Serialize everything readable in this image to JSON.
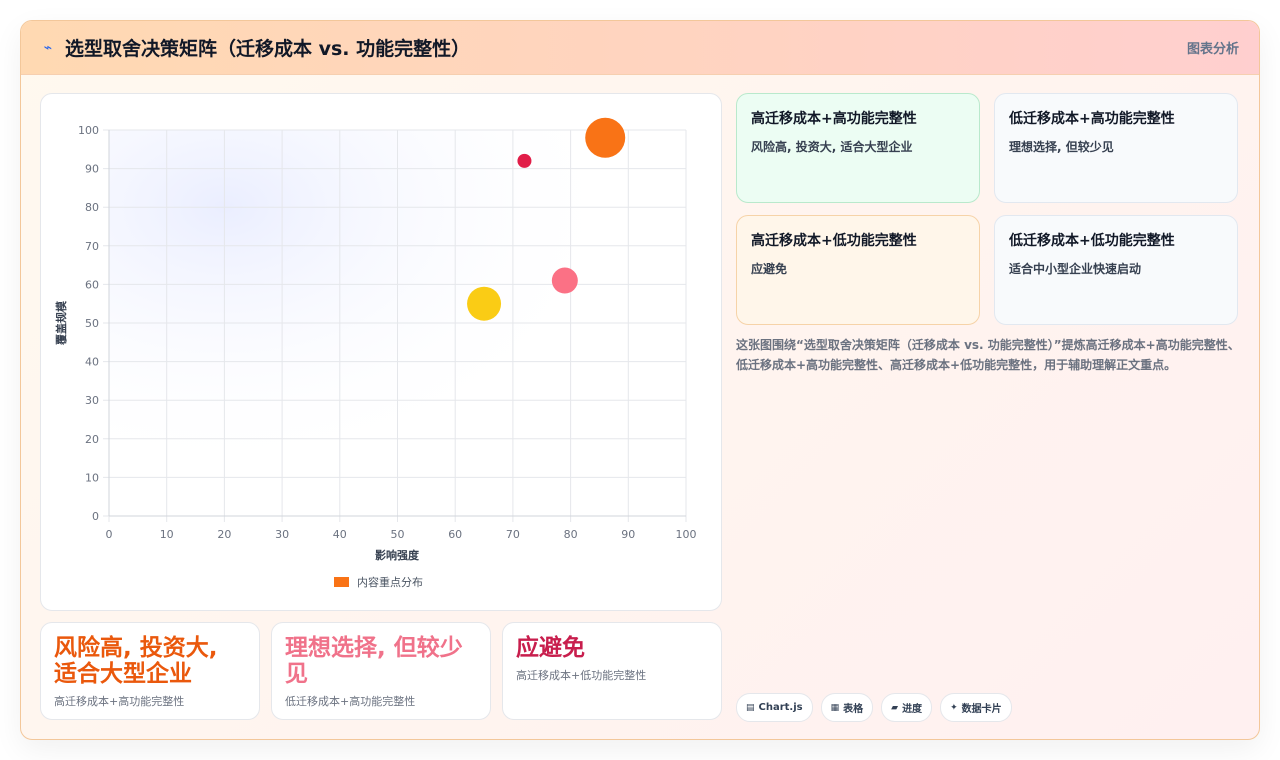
{
  "header": {
    "icon": "lightning-icon",
    "title": "选型取舍决策矩阵（迁移成本 vs. 功能完整性）",
    "link": "图表分析"
  },
  "chart_data": {
    "type": "scatter",
    "xlabel": "影响强度",
    "ylabel": "覆盖规模",
    "xlim": [
      0,
      100
    ],
    "ylim": [
      0,
      100
    ],
    "xticks": [
      "0",
      "10",
      "20",
      "30",
      "40",
      "50",
      "60",
      "70",
      "80",
      "90",
      "100"
    ],
    "yticks": [
      "0",
      "10",
      "20",
      "30",
      "40",
      "50",
      "60",
      "70",
      "80",
      "90",
      "100"
    ],
    "grid": true,
    "legend_position": "bottom",
    "series": [
      {
        "name": "内容重点分布",
        "color": "#f97316",
        "points": [
          {
            "x": 86,
            "y": 98,
            "r": 20,
            "color": "#f97316"
          },
          {
            "x": 72,
            "y": 92,
            "r": 7,
            "color": "#e11d48"
          },
          {
            "x": 79,
            "y": 61,
            "r": 13,
            "color": "#fb7185"
          },
          {
            "x": 65,
            "y": 55,
            "r": 17,
            "color": "#facc15"
          }
        ]
      }
    ]
  },
  "quadrants": [
    {
      "title": "高迁移成本+高功能完整性",
      "desc": "风险高, 投资大, 适合大型企业"
    },
    {
      "title": "低迁移成本+高功能完整性",
      "desc": "理想选择, 但较少见"
    },
    {
      "title": "高迁移成本+低功能完整性",
      "desc": "应避免"
    },
    {
      "title": "低迁移成本+低功能完整性",
      "desc": "适合中小型企业快速启动"
    }
  ],
  "description": "这张图围绕“选型取舍决策矩阵（迁移成本 vs. 功能完整性）”提炼高迁移成本+高功能完整性、低迁移成本+高功能完整性、高迁移成本+低功能完整性，用于辅助理解正文重点。",
  "kpi_cards": [
    {
      "big": "风险高, 投资大, 适合大型企业",
      "sub": "高迁移成本+高功能完整性"
    },
    {
      "big": "理想选择, 但较少见",
      "sub": "低迁移成本+高功能完整性"
    },
    {
      "big": "应避免",
      "sub": "高迁移成本+低功能完整性"
    }
  ],
  "tags": [
    {
      "icon": "chart-icon",
      "glyph": "▤",
      "label": "Chart.js"
    },
    {
      "icon": "table-icon",
      "glyph": "▦",
      "label": "表格"
    },
    {
      "icon": "progress-icon",
      "glyph": "▰",
      "label": "进度"
    },
    {
      "icon": "sparkle-icon",
      "glyph": "✦",
      "label": "数据卡片"
    }
  ]
}
